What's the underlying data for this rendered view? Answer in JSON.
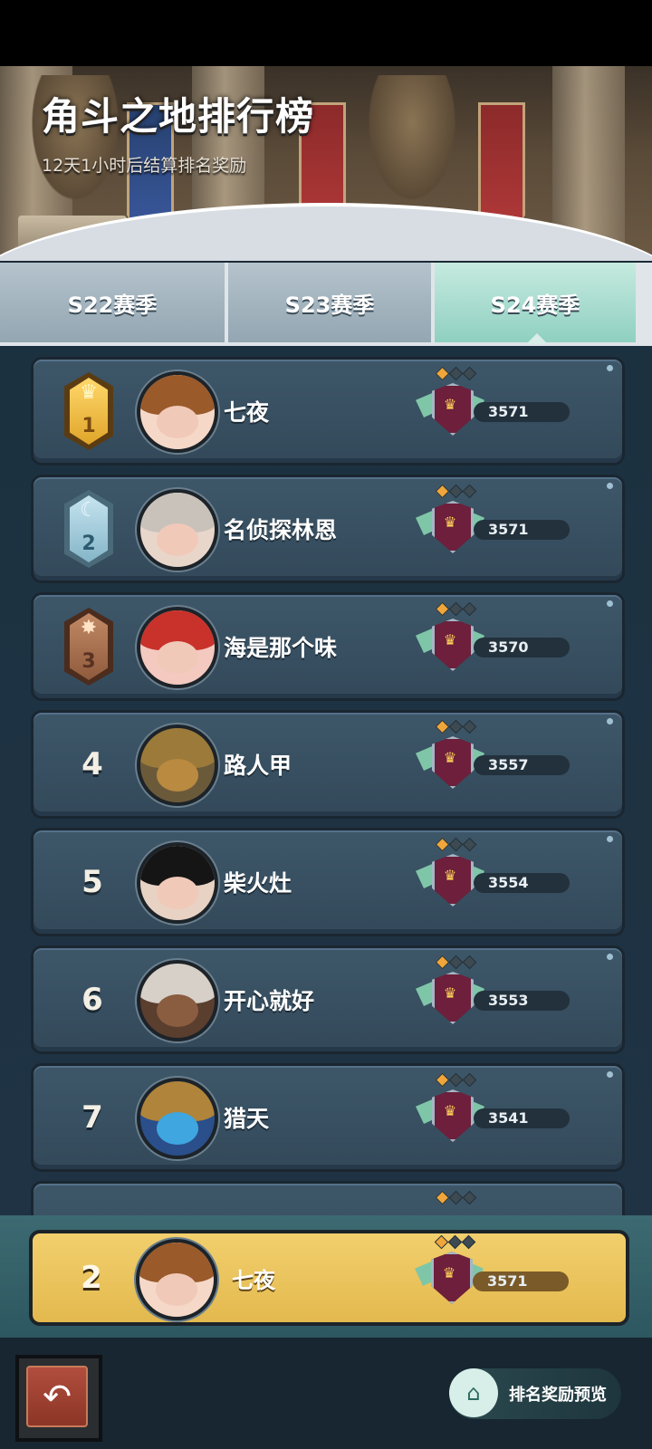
{
  "header": {
    "title": "角斗之地排行榜",
    "subtitle": "12天1小时后结算排名奖励"
  },
  "tabs": [
    {
      "label": "S22赛季",
      "selected": false
    },
    {
      "label": "S23赛季",
      "selected": false
    },
    {
      "label": "S24赛季",
      "selected": true
    }
  ],
  "leaderboard": [
    {
      "rank": "1",
      "name": "七夜",
      "score": "3571",
      "medal": "gold",
      "medal_glyph": "♛",
      "avatar_hat": "#9a5a2a"
    },
    {
      "rank": "2",
      "name": "名侦探林恩",
      "score": "3571",
      "medal": "silver",
      "medal_glyph": "☾",
      "avatar_hat": "#c9c2bb"
    },
    {
      "rank": "3",
      "name": "海是那个味",
      "score": "3570",
      "medal": "bronze",
      "medal_glyph": "✸",
      "avatar_hat": "#c8322a"
    },
    {
      "rank": "4",
      "name": "路人甲",
      "score": "3557",
      "medal": "none",
      "avatar_hat": "#9b7a3a"
    },
    {
      "rank": "5",
      "name": "柴火灶",
      "score": "3554",
      "medal": "none",
      "avatar_hat": "#151515"
    },
    {
      "rank": "6",
      "name": "开心就好",
      "score": "3553",
      "medal": "none",
      "avatar_hat": "#d6d0c8"
    },
    {
      "rank": "7",
      "name": "猎天",
      "score": "3541",
      "medal": "none",
      "avatar_hat": "#b0843a"
    }
  ],
  "my_entry": {
    "rank": "2",
    "name": "七夜",
    "score": "3571"
  },
  "bottom": {
    "back_icon": "↶",
    "reward_preview_label": "排名奖励预览",
    "reward_icon": "⌂"
  },
  "colors": {
    "row_bg": "#3d5769",
    "my_row_bg": "#e9c25a",
    "selected_tab": "#a6dccf"
  }
}
